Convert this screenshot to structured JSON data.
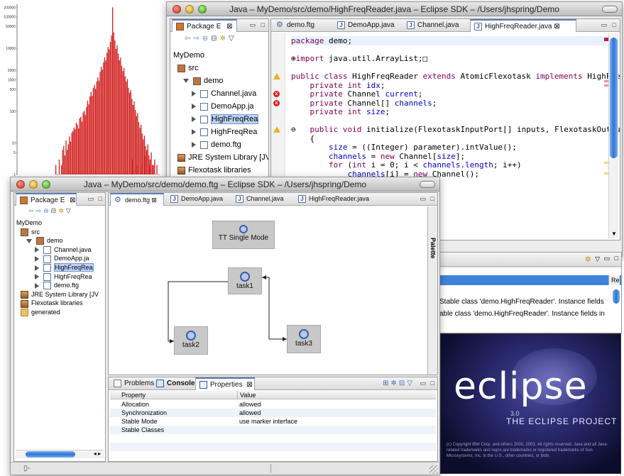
{
  "chart_data": {
    "type": "bar",
    "title": "",
    "xlabel": "",
    "ylabel": "",
    "yscale": "log",
    "yticks": [
      "200000",
      "100000",
      "50000",
      "10000",
      "2000",
      "1000",
      "500",
      "100",
      "10",
      "5",
      "1"
    ],
    "ytick_values": [
      200000,
      100000,
      50000,
      10000,
      2000,
      1000,
      500,
      100,
      10,
      5,
      1
    ],
    "ylim": [
      1,
      250000
    ],
    "bar_color": "#d21f1f",
    "values": [
      2,
      1,
      1,
      3,
      1,
      2,
      6,
      8,
      4,
      12,
      6,
      9,
      16,
      11,
      21,
      24,
      31,
      27,
      44,
      38,
      29,
      61,
      68,
      47,
      92,
      104,
      77,
      140,
      220,
      168,
      300,
      420,
      310,
      560,
      700,
      520,
      880,
      1220,
      940,
      1800,
      2600,
      2100,
      3600,
      5200,
      4100,
      7200,
      11000,
      9200,
      16000,
      26000,
      200000,
      32000,
      18000,
      9600,
      12500,
      6800,
      4200,
      5100,
      2800,
      1900,
      2400,
      1300,
      880,
      1060,
      560,
      390,
      470,
      250,
      160,
      210,
      112,
      72,
      90,
      46,
      30,
      38,
      20,
      13,
      17,
      8,
      6,
      9,
      4,
      3,
      5,
      2,
      2,
      3,
      1,
      2,
      1,
      1
    ],
    "stray_bars": [
      3,
      2,
      2,
      4,
      2
    ]
  },
  "back_window": {
    "title": "Java – MyDemo/src/demo/HighFreqReader.java – Eclipse SDK – /Users/jhspring/Demo",
    "package_explorer": {
      "tab_label": "Package E",
      "tree": [
        {
          "label": "MyDemo",
          "level": 0,
          "icon": "project-icon"
        },
        {
          "label": "src",
          "level": 1,
          "icon": "source-folder-icon"
        },
        {
          "label": "demo",
          "level": 2,
          "icon": "package-icon",
          "open": true
        },
        {
          "label": "Channel.java",
          "level": 3,
          "icon": "java-file-icon"
        },
        {
          "label": "DemoApp.ja",
          "level": 3,
          "icon": "java-file-icon"
        },
        {
          "label": "HighFreqRea",
          "level": 3,
          "icon": "java-file-icon",
          "selected": true
        },
        {
          "label": "HighFreqRea",
          "level": 3,
          "icon": "java-file-icon"
        },
        {
          "label": "demo.ftg",
          "level": 3,
          "icon": "gear-icon"
        },
        {
          "label": "JRE System Library [JV",
          "level": 1,
          "icon": "library-icon"
        },
        {
          "label": "Flexotask libraries",
          "level": 1,
          "icon": "library-icon"
        },
        {
          "label": "generated",
          "level": 1,
          "icon": "folder-icon"
        }
      ]
    },
    "editor_tabs": [
      {
        "label": "demo.ftg",
        "icon": "gear-icon"
      },
      {
        "label": "DemoApp.java",
        "icon": "java-file-icon"
      },
      {
        "label": "Channel.java",
        "icon": "java-file-icon"
      },
      {
        "label": "HighFreqReader.java",
        "icon": "java-file-icon",
        "selected": true
      }
    ],
    "code_lines": [
      {
        "text": "package demo;",
        "marker": ""
      },
      {
        "text": "",
        "marker": ""
      },
      {
        "text": "⊕import java.util.ArrayList;□",
        "marker": ""
      },
      {
        "text": "",
        "marker": ""
      },
      {
        "text": "public class HighFreqReader extends AtomicFlexotask implements HighFreqRe",
        "marker": "warning"
      },
      {
        "text": "    private int idx;",
        "marker": ""
      },
      {
        "text": "    private Channel current;",
        "marker": "error"
      },
      {
        "text": "    private Channel[] channels;",
        "marker": "error"
      },
      {
        "text": "    private int size;",
        "marker": ""
      },
      {
        "text": "",
        "marker": ""
      },
      {
        "text": "⊖   public void initialize(FlexotaskInputPort[] inputs, FlexotaskOutputPo",
        "marker": "warning"
      },
      {
        "text": "    {",
        "marker": ""
      },
      {
        "text": "        size = ((Integer) parameter).intValue();",
        "marker": ""
      },
      {
        "text": "        channels = new Channel[size];",
        "marker": ""
      },
      {
        "text": "        for (int i = 0; i < channels.length; i++)",
        "marker": ""
      },
      {
        "text": "            channels[i] = new Channel();",
        "marker": ""
      }
    ],
    "problems_lines": [
      "Stable class 'demo.HighFreqReader'. Instance fields",
      "able class 'demo.HighFreqReader'. Instance fields in"
    ],
    "problems_header_col": "Re"
  },
  "front_window": {
    "title": "Java – MyDemo/src/demo/demo.ftg – Eclipse SDK – /Users/jhspring/Demo",
    "package_explorer": {
      "tab_label": "Package E",
      "tree": [
        {
          "label": "MyDemo",
          "level": 0,
          "icon": "project-icon"
        },
        {
          "label": "src",
          "level": 1,
          "icon": "source-folder-icon"
        },
        {
          "label": "demo",
          "level": 2,
          "icon": "package-icon",
          "open": true
        },
        {
          "label": "Channel.java",
          "level": 3,
          "icon": "java-file-icon"
        },
        {
          "label": "DemoApp.ja",
          "level": 3,
          "icon": "java-file-icon"
        },
        {
          "label": "HighFreqRea",
          "level": 3,
          "icon": "java-file-icon",
          "selected": true
        },
        {
          "label": "HighFreqRea",
          "level": 3,
          "icon": "java-file-icon"
        },
        {
          "label": "demo.ftg",
          "level": 3,
          "icon": "gear-icon"
        },
        {
          "label": "JRE System Library [JV",
          "level": 1,
          "icon": "library-icon"
        },
        {
          "label": "Flexotask libraries",
          "level": 1,
          "icon": "library-icon"
        },
        {
          "label": "generated",
          "level": 1,
          "icon": "folder-icon"
        }
      ]
    },
    "editor_tabs": [
      {
        "label": "demo.ftg",
        "icon": "gear-icon",
        "selected": true
      },
      {
        "label": "DemoApp.java",
        "icon": "java-file-icon"
      },
      {
        "label": "Channel.java",
        "icon": "java-file-icon"
      },
      {
        "label": "HighFreqReader.java",
        "icon": "java-file-icon"
      }
    ],
    "palette_label": "Palette",
    "diagram": {
      "mode_node": "TT Single Mode",
      "nodes": [
        "task1",
        "task2",
        "task3"
      ]
    },
    "bottom_tabs": [
      {
        "label": "Problems",
        "icon": "problems-icon"
      },
      {
        "label": "Console",
        "icon": "console-icon",
        "bold": true
      },
      {
        "label": "Properties",
        "icon": "properties-icon",
        "selected": true
      }
    ],
    "properties": {
      "headers": [
        "Property",
        "Value"
      ],
      "rows": [
        {
          "property": "Allocation",
          "value": "allowed"
        },
        {
          "property": "Synchronization",
          "value": "allowed"
        },
        {
          "property": "Stable Mode",
          "value": "use marker interface"
        },
        {
          "property": "Stable Classes",
          "value": ""
        }
      ]
    }
  },
  "splash": {
    "wordmark": "eclipse",
    "version": "3.0",
    "subtitle": "THE ECLIPSE PROJECT",
    "copyright": "(c) Copyright IBM Corp. and others 2000, 2003. All rights reserved. Java and all Java-related trademarks and logos are trademarks or registered trademarks of Sun Microsystems, Inc. in the U.S., other countries, or both."
  }
}
